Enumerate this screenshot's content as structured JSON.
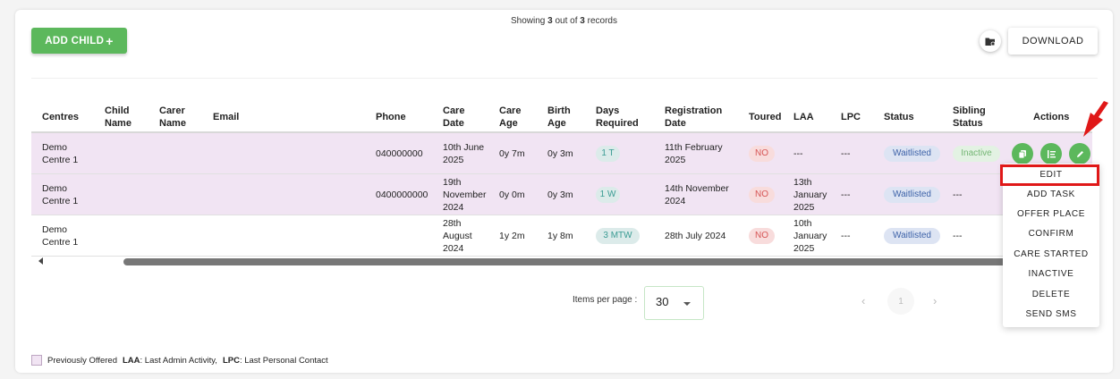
{
  "header": {
    "showing_prefix": "Showing ",
    "showing_count": "3",
    "showing_middle": " out of ",
    "showing_total": "3",
    "showing_suffix": " records",
    "add_child_label": "ADD CHILD",
    "add_child_icon": "+",
    "download_label": "DOWNLOAD"
  },
  "table": {
    "columns": [
      "Centres",
      "Child\nName",
      "Carer\nName",
      "Email",
      "Phone",
      "Care\nDate",
      "Care\nAge",
      "Birth\nAge",
      "Days\nRequired",
      "Registration\nDate",
      "Toured",
      "LAA",
      "LPC",
      "Status",
      "Sibling\nStatus",
      "Actions"
    ],
    "rows": [
      {
        "centre": "Demo\nCentre 1",
        "child_name": "",
        "carer_name": "",
        "email": "",
        "phone": "040000000",
        "care_date": "10th June\n2025",
        "care_age": "0y 7m",
        "birth_age": "0y 3m",
        "days": "1 T",
        "registration": "11th February\n2025",
        "toured": "NO",
        "laa": "---",
        "lpc": "---",
        "status": "Waitlisted",
        "sibling_status": "Inactive",
        "previously_offered": true
      },
      {
        "centre": "Demo\nCentre 1",
        "child_name": "",
        "carer_name": "",
        "email": "",
        "phone": "0400000000",
        "care_date": "19th\nNovember\n2024",
        "care_age": "0y 0m",
        "birth_age": "0y 3m",
        "days": "1 W",
        "registration": "14th November\n2024",
        "toured": "NO",
        "laa": "13th\nJanuary\n2025",
        "lpc": "---",
        "status": "Waitlisted",
        "sibling_status": "---",
        "previously_offered": true
      },
      {
        "centre": "Demo\nCentre 1",
        "child_name": "",
        "carer_name": "",
        "email": "",
        "phone": "",
        "care_date": "28th\nAugust\n2024",
        "care_age": "1y 2m",
        "birth_age": "1y 8m",
        "days": "3 MTW",
        "registration": "28th July 2024",
        "toured": "NO",
        "laa": "10th\nJanuary\n2025",
        "lpc": "---",
        "status": "Waitlisted",
        "sibling_status": "---",
        "previously_offered": false
      }
    ],
    "action_icons": [
      "copy-icon",
      "list-icon",
      "pencil-icon"
    ]
  },
  "pagination": {
    "items_per_page_label": "Items per page :",
    "items_per_page_value": "30",
    "prev": "‹",
    "current_page": "1",
    "next": "›"
  },
  "legend": {
    "previously_offered": "Previously Offered",
    "laa_abbr": "LAA",
    "laa_text": " : Last Admin Activity,",
    "lpc_abbr": "LPC",
    "lpc_text": " : Last Personal Contact"
  },
  "context_menu": {
    "items": [
      "EDIT",
      "ADD TASK",
      "OFFER PLACE",
      "CONFIRM",
      "CARE STARTED",
      "INACTIVE",
      "DELETE",
      "SEND SMS"
    ],
    "highlighted": "EDIT"
  },
  "colors": {
    "primary_green": "#5cb85c",
    "row_highlight": "#f1e4f3",
    "status_waitlisted_bg": "#dde4f3",
    "toured_no_bg": "#f8dcdc",
    "annotation_red": "#e01818"
  }
}
